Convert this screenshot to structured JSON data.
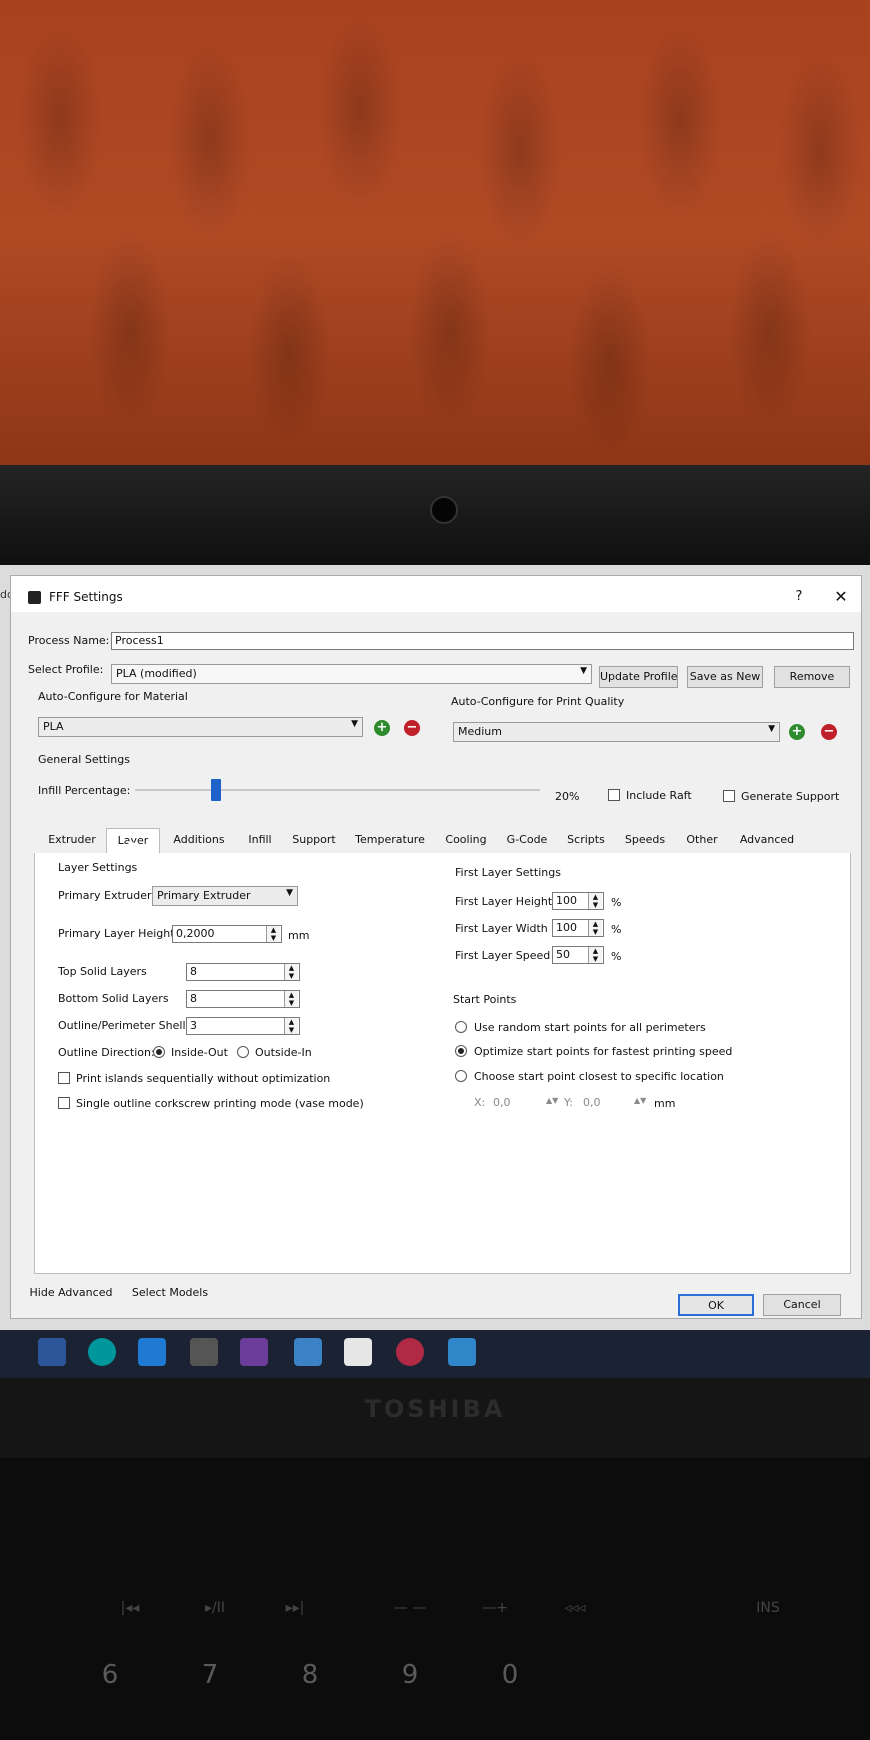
{
  "window": {
    "title": "FFF Settings",
    "help_label": "?",
    "close_label": "✕",
    "edge_text": "dd"
  },
  "process": {
    "name_label": "Process Name:",
    "name_value": "Process1"
  },
  "profile": {
    "label": "Select Profile:",
    "value": "PLA (modified)",
    "update_label": "Update Profile",
    "save_new_label": "Save as New",
    "remove_label": "Remove"
  },
  "material": {
    "label": "Auto-Configure for Material",
    "value": "PLA"
  },
  "quality": {
    "label": "Auto-Configure for Print Quality",
    "value": "Medium"
  },
  "general": {
    "label": "General Settings",
    "infill_label": "Infill Percentage:",
    "infill_value": "20%",
    "infill_fraction": 0.2,
    "raft_label": "Include Raft",
    "support_label": "Generate Support"
  },
  "tabs": [
    "Extruder",
    "Layer",
    "Additions",
    "Infill",
    "Support",
    "Temperature",
    "Cooling",
    "G-Code",
    "Scripts",
    "Speeds",
    "Other",
    "Advanced"
  ],
  "layer": {
    "section_label": "Layer Settings",
    "primary_extruder_label": "Primary Extruder",
    "primary_extruder_value": "Primary Extruder",
    "layer_height_label": "Primary Layer Height",
    "layer_height_value": "0,2000",
    "layer_height_unit": "mm",
    "top_solid_label": "Top Solid Layers",
    "top_solid_value": "8",
    "bottom_solid_label": "Bottom Solid Layers",
    "bottom_solid_value": "8",
    "shells_label": "Outline/Perimeter Shells",
    "shells_value": "3",
    "direction_label": "Outline Direction:",
    "inside_out_label": "Inside-Out",
    "outside_in_label": "Outside-In",
    "islands_label": "Print islands sequentially without optimization",
    "vase_label": "Single outline corkscrew printing mode (vase mode)"
  },
  "first_layer": {
    "section_label": "First Layer Settings",
    "height_label": "First Layer Height",
    "height_value": "100",
    "width_label": "First Layer Width",
    "width_value": "100",
    "speed_label": "First Layer Speed",
    "speed_value": "50",
    "unit": "%"
  },
  "start_points": {
    "section_label": "Start Points",
    "random_label": "Use random start points for all perimeters",
    "optimize_label": "Optimize start points for fastest printing speed",
    "closest_label": "Choose start point closest to specific location",
    "x_label": "X:",
    "x_value": "0,0",
    "y_label": "Y:",
    "y_value": "0,0",
    "unit": "mm"
  },
  "footer": {
    "hide_label": "Hide Advanced",
    "select_label": "Select Models",
    "ok_label": "OK",
    "cancel_label": "Cancel"
  },
  "device": {
    "brand": "TOSHIBA",
    "fkeys": [
      "|◂◂",
      "▸/II",
      "▸▸|",
      "—  —",
      "—+",
      "◃◃◃",
      "INS"
    ],
    "numkeys": [
      "6",
      "7",
      "8",
      "9",
      "0"
    ]
  },
  "colors": {
    "accent": "#1d63c9",
    "add": "#2e8b2e",
    "remove": "#c0202a",
    "taskbar": "#1b2233"
  }
}
